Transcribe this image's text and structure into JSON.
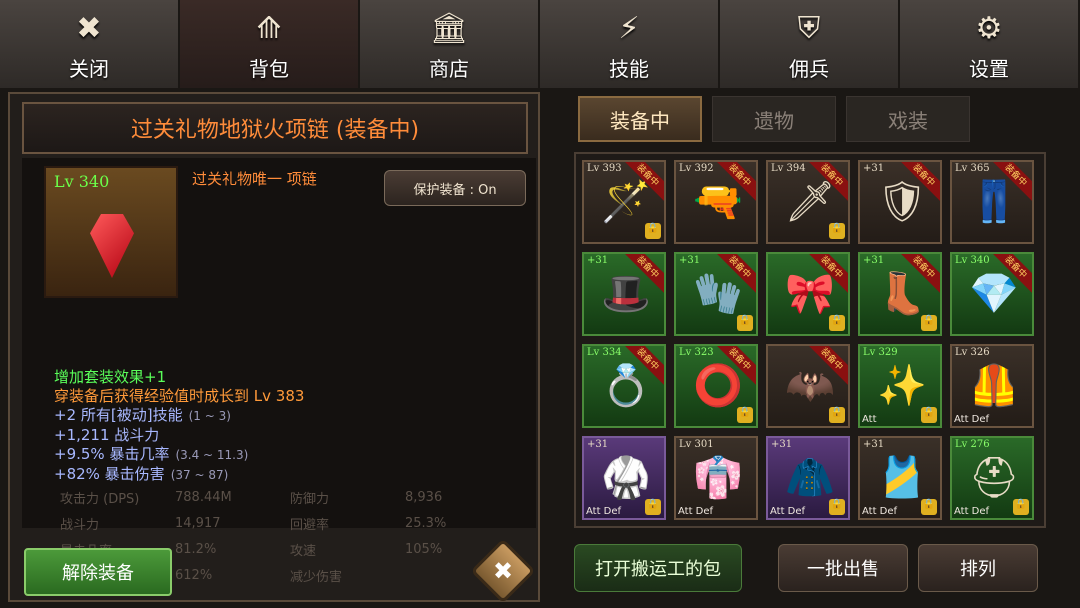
{
  "nav": [
    {
      "label": "关闭",
      "icon": "close-icon",
      "glyph": "✖"
    },
    {
      "label": "背包",
      "icon": "backpack-icon",
      "glyph": "⟰"
    },
    {
      "label": "商店",
      "icon": "shop-icon",
      "glyph": "🏛"
    },
    {
      "label": "技能",
      "icon": "lightning-icon",
      "glyph": "⚡"
    },
    {
      "label": "佣兵",
      "icon": "shield-icon",
      "glyph": "⛨"
    },
    {
      "label": "设置",
      "icon": "gear-icon",
      "glyph": "⚙"
    }
  ],
  "detail": {
    "title": "过关礼物地狱火项链 (装备中)",
    "item_level": "Lv 340",
    "subtitle": "过关礼物唯一 项链",
    "protect_label": "保护装备 : On",
    "effects": [
      {
        "text": "增加套装效果+1",
        "range": "",
        "color": "g"
      },
      {
        "text": "穿装备后获得经验值时成长到 Lv 383",
        "range": "",
        "color": "o"
      },
      {
        "text": "+2 所有[被动]技能",
        "range": "(1 ~ 3)",
        "color": "b"
      },
      {
        "text": "+1,211 战斗力",
        "range": "",
        "color": "b"
      },
      {
        "text": "+9.5% 暴击几率",
        "range": "(3.4 ~ 11.3)",
        "color": "b"
      },
      {
        "text": "+82% 暴击伤害",
        "range": "(37 ~ 87)",
        "color": "b"
      }
    ],
    "stats": [
      [
        "攻击力 (DPS)",
        "788.44M",
        "防御力",
        "8,936"
      ],
      [
        "战斗力",
        "14,917",
        "回避率",
        "25.3%"
      ],
      [
        "暴击几率",
        "81.2%",
        "攻速",
        "105%"
      ],
      [
        "",
        "612%",
        "减少伤害",
        ""
      ]
    ],
    "unequip_label": "解除装备"
  },
  "subtabs": [
    "装备中",
    "遗物",
    "戏装"
  ],
  "badge_text": "装备中",
  "grid": [
    {
      "lvl": "Lv 393",
      "badge": true,
      "lock": true,
      "glyph": "🪄",
      "style": "",
      "ad": ""
    },
    {
      "lvl": "Lv 392",
      "badge": true,
      "lock": false,
      "glyph": "🔫",
      "style": "",
      "ad": ""
    },
    {
      "lvl": "Lv 394",
      "badge": true,
      "lock": true,
      "glyph": "🗡",
      "style": "",
      "ad": ""
    },
    {
      "lvl": "+31",
      "badge": true,
      "lock": false,
      "glyph": "🛡",
      "style": "",
      "ad": ""
    },
    {
      "lvl": "Lv 365",
      "badge": true,
      "lock": false,
      "glyph": "👖",
      "style": "",
      "ad": ""
    },
    {
      "lvl": "+31",
      "badge": true,
      "lock": false,
      "glyph": "🎩",
      "style": "green",
      "ad": ""
    },
    {
      "lvl": "+31",
      "badge": true,
      "lock": true,
      "glyph": "🧤",
      "style": "green",
      "ad": ""
    },
    {
      "lvl": "",
      "badge": true,
      "lock": true,
      "glyph": "🎀",
      "style": "green",
      "ad": ""
    },
    {
      "lvl": "+31",
      "badge": true,
      "lock": true,
      "glyph": "👢",
      "style": "green",
      "ad": ""
    },
    {
      "lvl": "Lv 340",
      "badge": true,
      "lock": false,
      "glyph": "💎",
      "style": "green",
      "ad": ""
    },
    {
      "lvl": "Lv 334",
      "badge": true,
      "lock": false,
      "glyph": "💍",
      "style": "green",
      "ad": ""
    },
    {
      "lvl": "Lv 323",
      "badge": true,
      "lock": true,
      "glyph": "⭕",
      "style": "green",
      "ad": ""
    },
    {
      "lvl": "",
      "badge": true,
      "lock": true,
      "glyph": "🦇",
      "style": "",
      "ad": ""
    },
    {
      "lvl": "Lv 329",
      "badge": false,
      "lock": true,
      "glyph": "✨",
      "style": "green",
      "ad": "Att"
    },
    {
      "lvl": "Lv 326",
      "badge": false,
      "lock": false,
      "glyph": "🦺",
      "style": "",
      "ad": "Att Def"
    },
    {
      "lvl": "+31",
      "badge": false,
      "lock": true,
      "glyph": "🥋",
      "style": "purple",
      "ad": "Att Def"
    },
    {
      "lvl": "Lv 301",
      "badge": false,
      "lock": false,
      "glyph": "👘",
      "style": "",
      "ad": "Att Def"
    },
    {
      "lvl": "+31",
      "badge": false,
      "lock": true,
      "glyph": "🧥",
      "style": "purple",
      "ad": "Att Def"
    },
    {
      "lvl": "+31",
      "badge": false,
      "lock": true,
      "glyph": "🎽",
      "style": "",
      "ad": "Att Def"
    },
    {
      "lvl": "Lv 276",
      "badge": false,
      "lock": true,
      "glyph": "⛑",
      "style": "green",
      "ad": "Att Def"
    }
  ],
  "bottom": {
    "open_bag": "打开搬运工的包",
    "bulk_sell": "一批出售",
    "sort": "排列"
  }
}
